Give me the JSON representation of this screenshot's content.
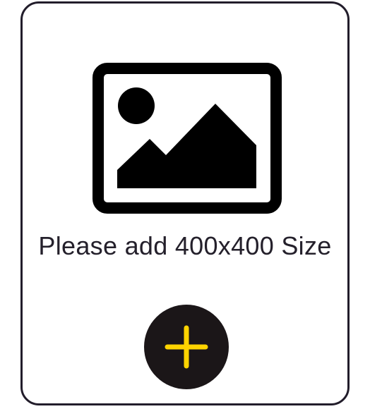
{
  "upload": {
    "prompt": "Please add 400x400 Size",
    "icon": "image-icon",
    "button_icon": "plus-icon"
  },
  "colors": {
    "border": "#221d2b",
    "icon": "#000000",
    "text": "#24202b",
    "button_background": "#1b1618",
    "button_plus": "#ffd400"
  }
}
